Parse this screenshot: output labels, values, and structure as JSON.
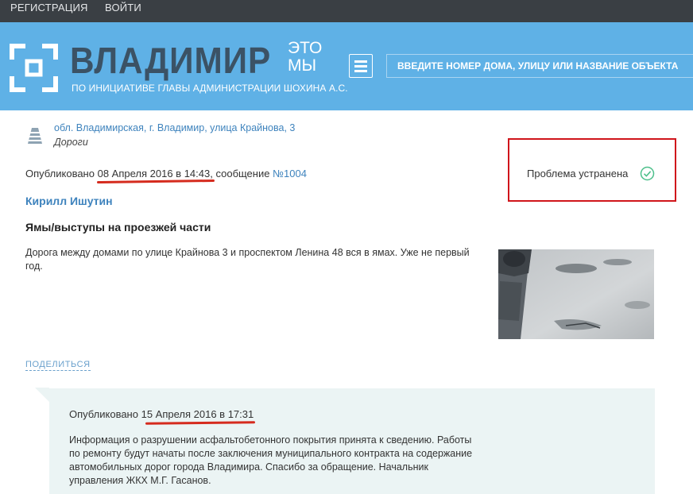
{
  "topbar": {
    "register": "РЕГИСТРАЦИЯ",
    "login": "ВОЙТИ"
  },
  "header": {
    "brand": "ВЛАДИМИР",
    "brand_suffix_top": "ЭТО",
    "brand_suffix_bottom": "МЫ",
    "subtitle": "ПО ИНИЦИАТИВЕ ГЛАВЫ АДМИНИСТРАЦИИ ШОХИНА А.С.",
    "search_placeholder": "ВВЕДИТЕ НОМЕР ДОМА, УЛИЦУ ИЛИ НАЗВАНИЕ ОБЪЕКТА",
    "logo_icon": "bracket-frame-logo-icon",
    "menu_icon": "hamburger-menu-icon"
  },
  "issue": {
    "address": "обл. Владимирская, г. Владимир, улица Крайнова, 3",
    "category": "Дороги",
    "category_icon": "road-icon",
    "published_prefix": "Опубликовано ",
    "published_date": "08 Апреля 2016 в 14:43",
    "message_prefix": ", сообщение ",
    "message_number": "№1004",
    "status": "Проблема устранена",
    "status_icon": "check-circle-icon",
    "author": "Кирилл Ишутин",
    "title": "Ямы/выступы на проезжей части",
    "body": "Дорога между домами по улице Крайнова 3 и проспектом Ленина 48 вся в ямах. Уже не первый год.",
    "photo_icon": "road-photo",
    "share_label": "ПОДЕЛИТЬСЯ"
  },
  "reply": {
    "published_prefix": "Опубликовано ",
    "published_date": "15 Апреля 2016 в 17:31",
    "body": "Информация о разрушении асфальтобетонного покрытия принята к сведению. Работы по ремонту будут начаты после заключения муниципального контракта на содержание автомобильных дорог города Владимира. Спасибо за обращение. Начальник управления ЖКХ М.Г. Гасанов."
  },
  "colors": {
    "topbar": "#3a3f44",
    "header": "#5fb1e6",
    "brand_text": "#3b5265",
    "link": "#3e83bd",
    "highlight": "#d0151b",
    "reply_bg": "#ebf4f4",
    "check": "#4cbf8a"
  }
}
